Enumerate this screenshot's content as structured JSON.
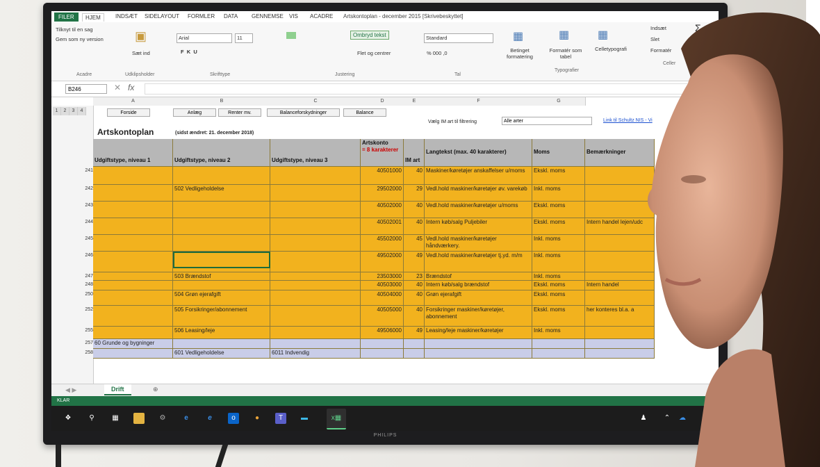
{
  "window_title": "Artskontoplan - december 2015 [Skrivebeskyttet]",
  "ribbon": {
    "tabs": [
      "FILER",
      "HJEM",
      "INDSÆT",
      "SIDELAYOUT",
      "FORMLER",
      "DATA",
      "GENNEMSE",
      "VIS",
      "ACADRE"
    ],
    "clipboard": {
      "copy_to": "Tilknyt til en sag",
      "save_as": "Gem som ny version",
      "paste": "Sæt ind",
      "group": "Udklipsholder"
    },
    "acadre_label": "Acadre",
    "font": {
      "name": "Arial",
      "size": "11",
      "group": "Skrifttype"
    },
    "alignment": {
      "wrap": "Ombryd tekst",
      "merge": "Flet og centrer",
      "group": "Justering"
    },
    "number": {
      "format": "Standard",
      "group": "Tal"
    },
    "styles": {
      "conditional": "Betinget formatering",
      "table": "Formatér som tabel",
      "cell": "Celletypografi",
      "group": "Typografier"
    },
    "cells": {
      "insert": "Indsæt",
      "delete": "Slet",
      "format": "Formatér",
      "group": "Celler"
    }
  },
  "formula_bar": {
    "name_box": "B246",
    "fx": "fx"
  },
  "columns": [
    "A",
    "B",
    "C",
    "D",
    "E",
    "F",
    "G"
  ],
  "outline_levels": [
    "1",
    "2",
    "3",
    "4"
  ],
  "nav_buttons": [
    "Forside",
    "Anlæg",
    "Renter mv.",
    "Balanceforskydninger",
    "Balance"
  ],
  "filter": {
    "label": "Vælg IM art til filtrering",
    "value": "Alle arter",
    "link": "Link til Schultz NIS - Vi"
  },
  "sheet": {
    "title": "Artskontoplan",
    "last_changed": "(sidst ændret: 21. december 2018)",
    "headers": {
      "a": "Udgiftstype, niveau 1",
      "b": "Udgiftstype, niveau 2",
      "c": "Udgiftstype, niveau 3",
      "d1": "Artskonto",
      "d2": "= 8 karakterer",
      "e": "IM art",
      "f": "Langtekst (max. 40 karakterer)",
      "g": "Moms",
      "h": "Bemærkninger"
    },
    "rows": [
      {
        "rn": "241",
        "b": "",
        "d": "40501000",
        "e": "40",
        "f": "Maskiner/køretøjer anskaffelser u/moms",
        "g": "Ekskl. moms",
        "h": ""
      },
      {
        "rn": "242",
        "b": "502 Vedligeholdelse",
        "d": "29502000",
        "e": "29",
        "f": "Vedl.hold maskiner/køretøjer øv. varekøb",
        "g": "Inkl. moms",
        "h": ""
      },
      {
        "rn": "243",
        "b": "",
        "d": "40502000",
        "e": "40",
        "f": "Vedl.hold maskiner/køretøjer u/moms",
        "g": "Ekskl. moms",
        "h": ""
      },
      {
        "rn": "244",
        "b": "",
        "d": "40502001",
        "e": "40",
        "f": "Intern køb/salg Puljebiler",
        "g": "Ekskl. moms",
        "h": "Intern handel lejen/udc"
      },
      {
        "rn": "245",
        "b": "",
        "d": "45502000",
        "e": "45",
        "f": "Vedl.hold maskiner/køretøjer håndværkery.",
        "g": "Inkl. moms",
        "h": ""
      },
      {
        "rn": "246",
        "b": "",
        "d": "49502000",
        "e": "49",
        "f": "Vedl.hold maskiner/køretøjer tj.yd. m/m",
        "g": "Inkl. moms",
        "h": ""
      },
      {
        "rn": "247",
        "b": "503 Brændstof",
        "d": "23503000",
        "e": "23",
        "f": "Brændstof",
        "g": "Inkl. moms",
        "h": ""
      },
      {
        "rn": "248",
        "b": "",
        "d": "40503000",
        "e": "40",
        "f": "Intern køb/salg brændstof",
        "g": "Ekskl. moms",
        "h": "Intern handel"
      },
      {
        "rn": "250",
        "b": "504 Grøn ejerafgift",
        "d": "40504000",
        "e": "40",
        "f": "Grøn ejerafgift",
        "g": "Ekskl. moms",
        "h": ""
      },
      {
        "rn": "252",
        "b": "505 Forsikringer/abonnement",
        "d": "40505000",
        "e": "40",
        "f": "Forsikringer maskiner/køretøjer, abonnement",
        "g": "Ekskl. moms",
        "h": "her konteres bl.a. a"
      },
      {
        "rn": "255",
        "b": "506 Leasing/leje",
        "d": "49506000",
        "e": "49",
        "f": "Leasing/leje maskiner/køretøjer",
        "g": "Inkl. moms",
        "h": ""
      }
    ],
    "lower_rows": [
      {
        "rn": "257",
        "a": "60 Grunde og bygninger",
        "b": ""
      },
      {
        "rn": "258",
        "a": "",
        "b": "601 Vedligeholdelse",
        "c": "6011 Indvendig"
      }
    ]
  },
  "sheet_tab": "Drift",
  "status": "KLAR",
  "monitor_brand": "PHILIPS",
  "colors": {
    "excel_green": "#217346",
    "row_orange": "#f2b21e",
    "header_gray": "#b7b7b7"
  }
}
